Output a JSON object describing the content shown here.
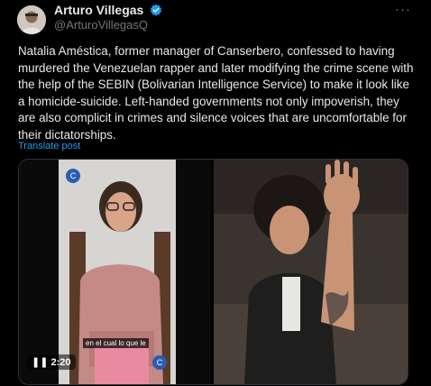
{
  "author": {
    "name": "Arturo Villegas",
    "handle": "@ArturoVillegasQ",
    "avatar_icon": "profile-photo-icon",
    "verified_icon": "verified-badge-icon"
  },
  "menu_icon": "more-options-icon",
  "post": {
    "text": "Natalia Améstica, former manager of Canserbero, confessed to having murdered the Venezuelan rapper and later modifying the crime scene with the help of the SEBIN (Bolivarian Intelligence Service) to make it look like a homicide-suicide. Left-handed governments not only impoverish, they are also complicit in crimes and silence voices that are uncomfortable for their dictatorships.",
    "translate_label": "Translate post"
  },
  "media": {
    "left_video": {
      "subtitle": "en el cual lo que le",
      "time_label": "2:20",
      "pause_icon": "pause-icon",
      "logo_icon": "broadcaster-logo-icon"
    },
    "right_image": {
      "description_icon": "photo-icon"
    }
  },
  "colors": {
    "background": "#000000",
    "text": "#e7e9ea",
    "secondary": "#71767b",
    "link": "#1d9bf0",
    "verified": "#1d9bf0"
  }
}
